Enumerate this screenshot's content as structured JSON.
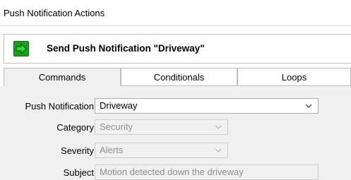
{
  "window": {
    "title": "Push Notification Actions"
  },
  "action": {
    "icon": "green-right-arrow-icon",
    "label": "Send Push Notification \"Driveway\""
  },
  "tabs": [
    {
      "label": "Commands",
      "active": true
    },
    {
      "label": "Conditionals",
      "active": false
    },
    {
      "label": "Loops",
      "active": false
    }
  ],
  "form": {
    "push_notification": {
      "label": "Push Notification",
      "value": "Driveway"
    },
    "category": {
      "label": "Category",
      "value": "Security"
    },
    "severity": {
      "label": "Severity",
      "value": "Alerts"
    },
    "subject": {
      "label": "Subject",
      "value": "Motion detected down the driveway"
    }
  },
  "colors": {
    "accent_green": "#1d9e1d",
    "panel_bg": "#f0f0f0",
    "disabled_text": "#8f8f8f"
  }
}
